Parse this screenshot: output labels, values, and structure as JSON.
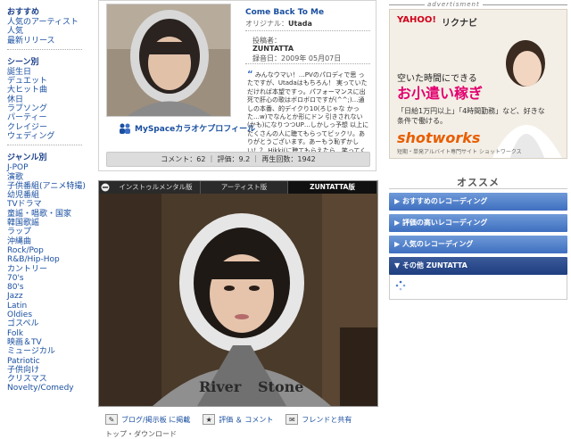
{
  "sidebar": {
    "sections": [
      {
        "heading": "おすすめ",
        "links": [
          "人気のアーティスト",
          "人気",
          "最新リリース"
        ]
      },
      {
        "heading": "シーン別",
        "links": [
          "誕生日",
          "デュエット",
          "大ヒット曲",
          "休日",
          "ラブソング",
          "パーティー",
          "クレイジー",
          "ウェディング"
        ]
      },
      {
        "heading": "ジャンル別",
        "links": [
          "J-POP",
          "演歌",
          "子供番組(アニメ特撮)",
          "幼児番組",
          "TVドラマ",
          "童謡・唱歌・国家",
          "韓国歌謡",
          "ラップ",
          "沖縄曲",
          "Rock/Pop",
          "R&B/Hip-Hop",
          "カントリー",
          "70's",
          "80's",
          "Jazz",
          "Latin",
          "Oldies",
          "ゴスペル",
          "Folk",
          "映画＆TV",
          "ミュージカル",
          "Patriotic",
          "子供向け",
          "クリスマス",
          "Novelty/Comedy"
        ]
      }
    ]
  },
  "song": {
    "title": "Come Back To Me",
    "original_label": "オリジナル：",
    "original_artist": "Utada",
    "poster_label": "投稿者：",
    "poster_name": "ZUNTATTA",
    "record_date": "録音日：2009年 05月07日",
    "comment": "みんなウマい！…PVのパロディで思 ったですが、Utadaはもちろん！ 実っていただければ本望ですっ。パフォーマンスに出死で肝心の歌はボロボロですが(^^;)…通しの本番、的デイクり10(ろじゃな かった…w)でなんとか形にドン 引きされない(かも)になりつつUP…しかしっ予想 以上にたくさんの人に聴てもらってビックリ。ありがとうございます。あーもう恥ずかしい！？ Hikki(に聴てもらえたら…笑ってくれる かなぁ。",
    "myspace_link": "MySpaceカラオケプロフィール",
    "stats": "コメント：62 ｜ 評価：9.2 ｜ 再生回数：1942"
  },
  "player": {
    "tabs": [
      "インストゥルメンタル版",
      "アーティスト版",
      "ZUNTATTA版"
    ],
    "active_tab": 2
  },
  "actions": {
    "blog": "ブログ/掲示板 に掲載",
    "rate": "評価 ＆ コメント",
    "share": "フレンドと共有",
    "next": "トップ・ダウンロード"
  },
  "ad": {
    "label": "advertisment",
    "logo1": "YAHOO!",
    "logo2": "リクナビ",
    "line1": "空いた時間にできる",
    "line2": "お小遣い稼ぎ",
    "line3": "「日給1万円以上」「4時間勤務」など、好きな条件で働ける。",
    "brand": "shotworks",
    "brand_sub": "短期・単発アルバイト専門サイト ショットワークス"
  },
  "recommend": {
    "title": "オススメ",
    "items": [
      "おすすめのレコーディング",
      "評価の高いレコーディング",
      "人気のレコーディング",
      "その他 ZUNTATTA"
    ]
  },
  "colors": {
    "link": "#1a4fa0",
    "rec_blue": "#3e6fc0",
    "ad_pink": "#e2006f",
    "ad_orange": "#e85d00"
  }
}
